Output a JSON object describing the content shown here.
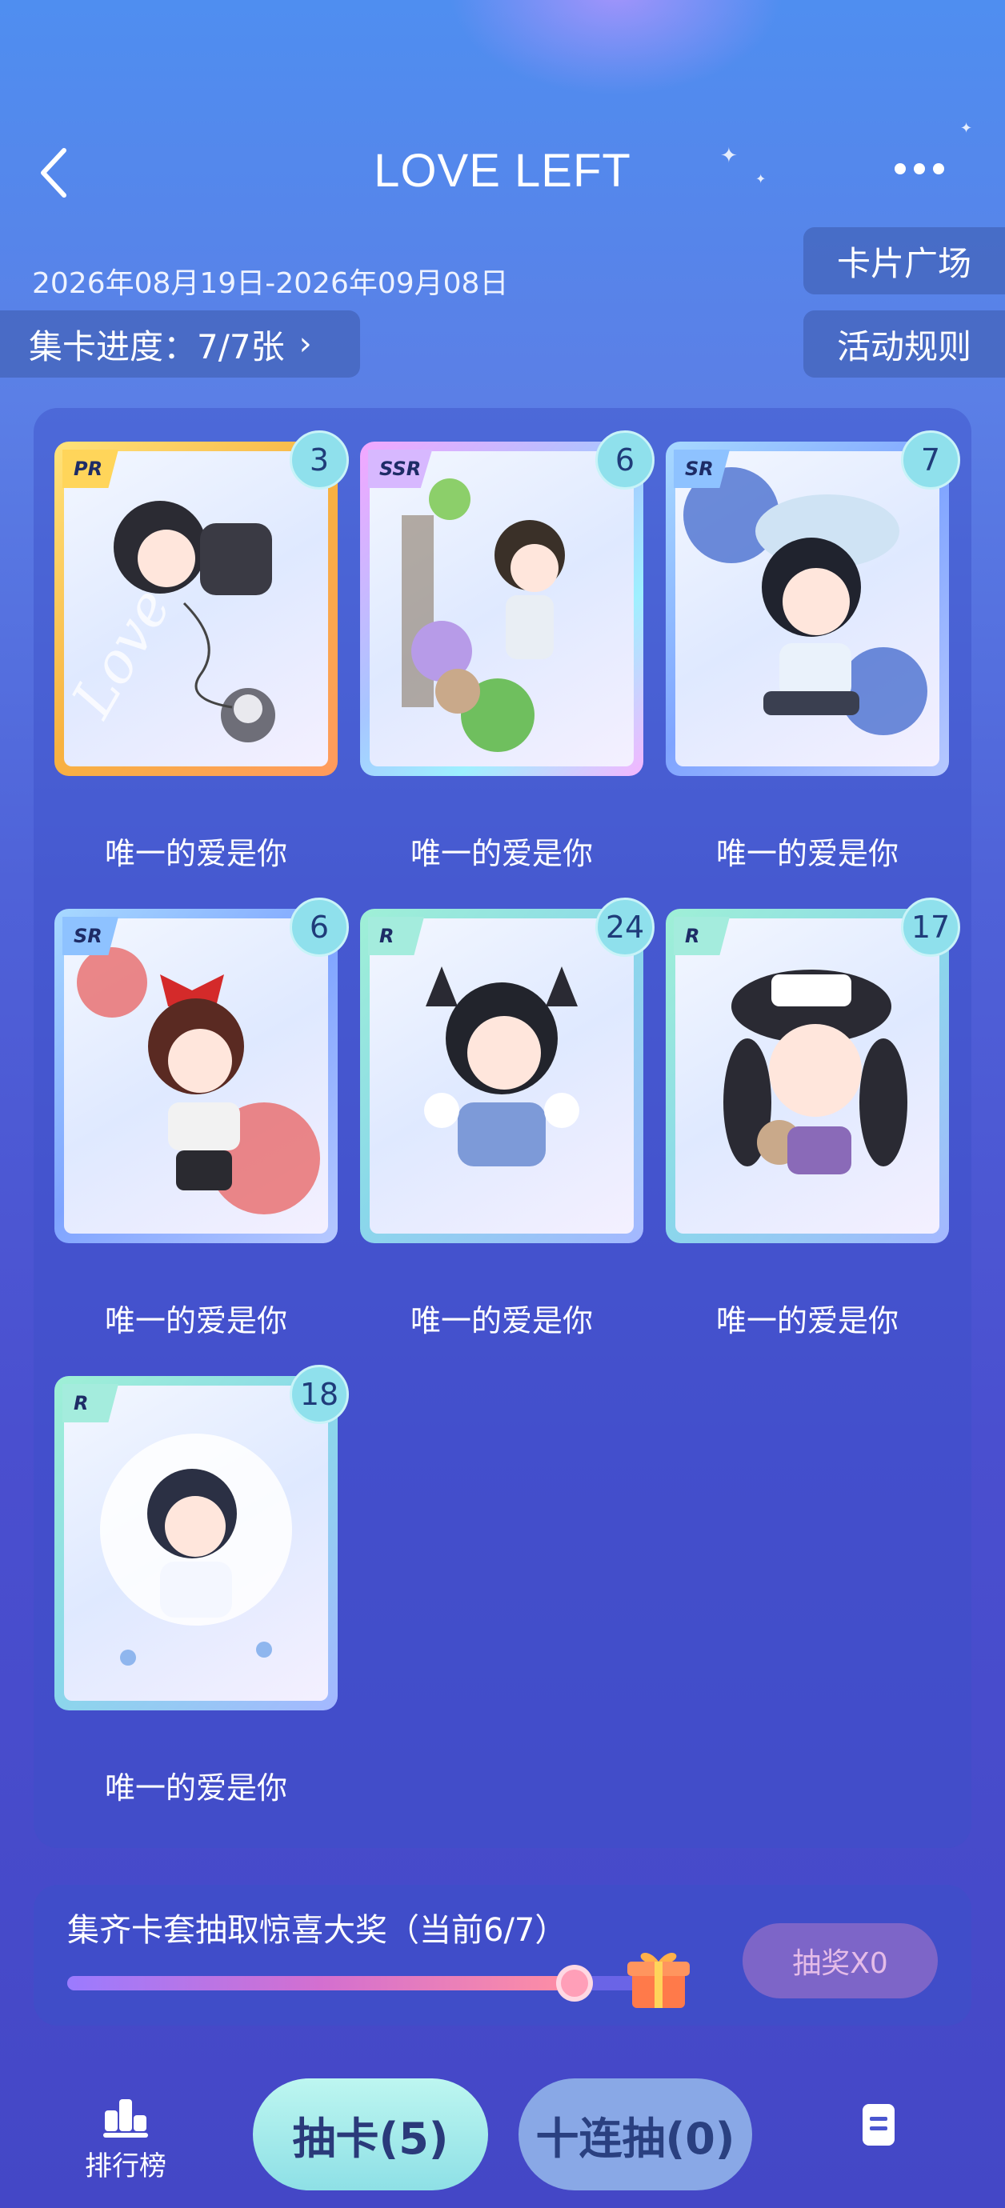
{
  "header": {
    "title": "LOVE LEFT",
    "date_range": "2026年08月19日-2026年09月08日",
    "progress_label": "集卡进度：7/7张",
    "card_square_label": "卡片广场",
    "rules_label": "活动规则"
  },
  "cards": [
    {
      "rarity": "PR",
      "count": "3",
      "label": "唯一的爱是你"
    },
    {
      "rarity": "SSR",
      "count": "6",
      "label": "唯一的爱是你"
    },
    {
      "rarity": "SR",
      "count": "7",
      "label": "唯一的爱是你"
    },
    {
      "rarity": "SR",
      "count": "6",
      "label": "唯一的爱是你"
    },
    {
      "rarity": "R",
      "count": "24",
      "label": "唯一的爱是你"
    },
    {
      "rarity": "R",
      "count": "17",
      "label": "唯一的爱是你"
    },
    {
      "rarity": "R",
      "count": "18",
      "label": "唯一的爱是你"
    }
  ],
  "bonus": {
    "text": "集齐卡套抽取惊喜大奖（当前6/7）",
    "progress": 0.857,
    "draw_button": "抽奖X0"
  },
  "bottom_bar": {
    "ranking_label": "排行榜",
    "draw_label": "抽卡(5)",
    "ten_draw_label": "十连抽(0)"
  },
  "icons": [
    "back-icon",
    "more-icon",
    "ranking-icon",
    "gift-icon",
    "record-icon"
  ]
}
